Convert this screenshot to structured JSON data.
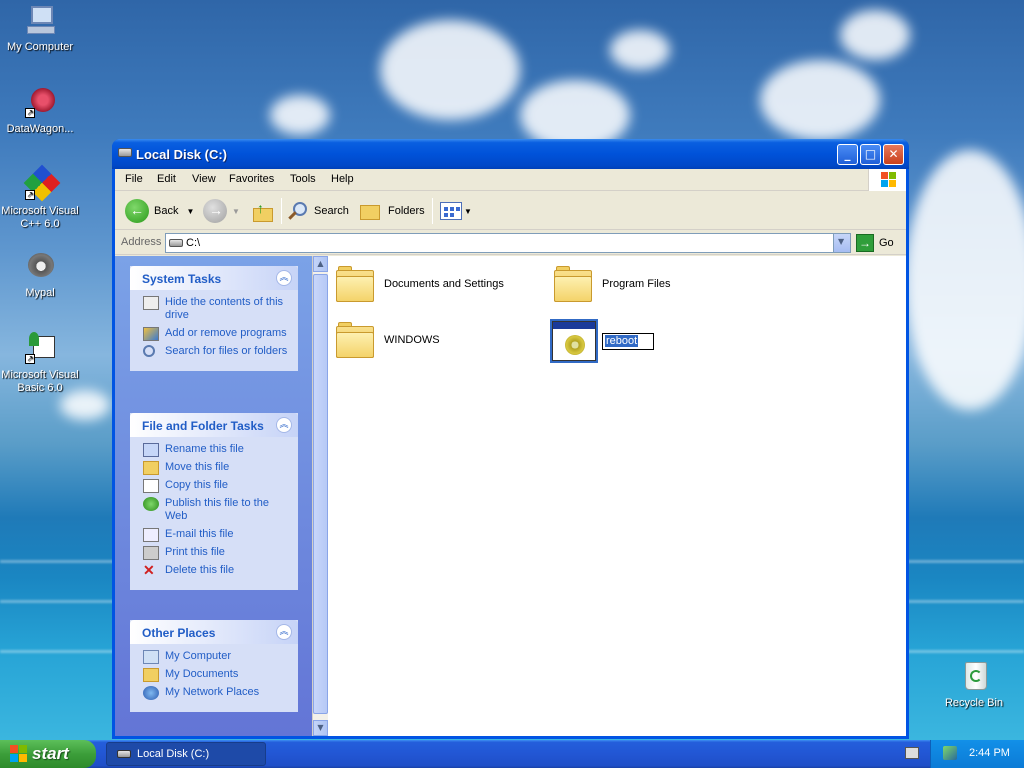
{
  "desktop": {
    "icons": [
      {
        "label": "My Computer"
      },
      {
        "label": "DataWagon..."
      },
      {
        "label": "Microsoft Visual C++ 6.0"
      },
      {
        "label": "Mypal"
      },
      {
        "label": "Microsoft Visual Basic 6.0"
      },
      {
        "label": "Recycle Bin"
      }
    ]
  },
  "window": {
    "title": "Local Disk (C:)",
    "menu": [
      "File",
      "Edit",
      "View",
      "Favorites",
      "Tools",
      "Help"
    ],
    "toolbar": {
      "back_label": "Back",
      "search_label": "Search",
      "folders_label": "Folders"
    },
    "address": {
      "label": "Address",
      "value": "C:\\",
      "go_label": "Go"
    }
  },
  "taskpane": {
    "system_tasks": {
      "title": "System Tasks",
      "items": [
        "Hide the contents of this drive",
        "Add or remove programs",
        "Search for files or folders"
      ]
    },
    "file_folder_tasks": {
      "title": "File and Folder Tasks",
      "items": [
        "Rename this file",
        "Move this file",
        "Copy this file",
        "Publish this file to the Web",
        "E-mail this file",
        "Print this file",
        "Delete this file"
      ]
    },
    "other_places": {
      "title": "Other Places",
      "items": [
        "My Computer",
        "My Documents",
        "My Network Places"
      ]
    }
  },
  "content": {
    "items": [
      {
        "name": "Documents and Settings",
        "type": "folder"
      },
      {
        "name": "Program Files",
        "type": "folder"
      },
      {
        "name": "WINDOWS",
        "type": "folder"
      },
      {
        "name": "reboot",
        "type": "batch-file"
      }
    ]
  },
  "taskbar": {
    "start_label": "start",
    "task_label": "Local Disk (C:)",
    "clock": "2:44 PM"
  },
  "colors": {
    "title_blue": "#0052d9",
    "taskpane_link": "#215dc6",
    "selection": "#316ac5",
    "start_green": "#3c9e3a"
  }
}
